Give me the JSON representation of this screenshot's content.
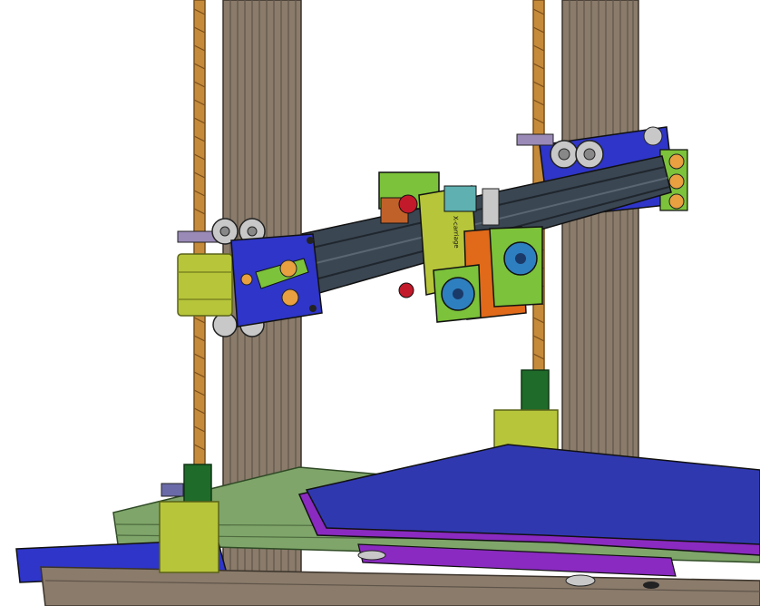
{
  "scene": {
    "subject": "3d-printer-cad-render",
    "carriage_text": "X-carriage",
    "colors": {
      "background": "#ffffff",
      "frame_extrusion": "#8a7b6b",
      "frame_extrusion_dark": "#5f5449",
      "leadscrew": "#c58a3a",
      "leadscrew_dark": "#7a4f1b",
      "x_beam": "#3a4652",
      "x_beam_dark": "#20262d",
      "motor": "#b7c53a",
      "motor_dark": "#7b8720",
      "blue_plate": "#2e35c8",
      "green_part": "#7cc23a",
      "orange_part": "#e06a1a",
      "purple": "#8a2ac0",
      "bed": "#3038b0",
      "base_rail": "#7fa56a",
      "coupler": "#1f6b2a",
      "wheel": "#c8c8c8",
      "red_part": "#c21a2a"
    }
  }
}
